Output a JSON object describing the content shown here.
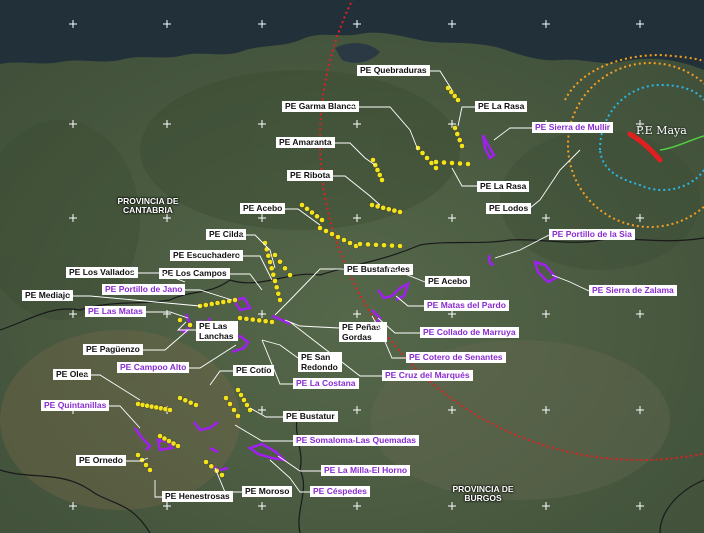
{
  "map": {
    "colors": {
      "land": "#4d5e44",
      "sea": "#22303a",
      "white_label_text": "#111111",
      "purple": "#a020f0",
      "yellow": "#f2e31a",
      "red_circle": "#e02020",
      "orange_circle": "#f5a020",
      "blue_circle": "#2ab8e8",
      "green_line": "#50d040"
    },
    "labels": {
      "quebraduras": "PE Quebraduras",
      "la_rasa_1": "PE La Rasa",
      "garma_blanca": "PE Garma Blanca",
      "sierra_mullir": "PE Sierra de Mullir",
      "amaranta": "PE Amaranta",
      "ribota": "PE Ribota",
      "la_rasa_2": "PE La Rasa",
      "lodos": "PE Lodos",
      "acebo_1": "PE Acebo",
      "cilda": "PE Cilda",
      "portillo_sia": "PE Portillo de la Sia",
      "escuchadero": "PE Escuchadero",
      "los_vallados": "PE Los Vallados",
      "los_campos": "PE Los Campos",
      "bustafrades": "PE Bustafrades",
      "acebo_2": "PE Acebo",
      "sierra_zalama": "PE Sierra de Zalama",
      "mediajo": "PE Mediajo",
      "portillo_jano": "PE Portillo de Jano",
      "matas_pardo": "PE Matas del Pardo",
      "las_matas": "PE Las Matas",
      "las_lanchas": "PE Las Lanchas",
      "penas_gordas": "PE Peñas Gordas",
      "collado_marruya": "PE Collado de Marruya",
      "paguenzo": "PE Pagüenzo",
      "cotero_senantes": "PE Cotero de Senantes",
      "campoo_alto": "PE Campoo Alto",
      "san_redondo": "PE San Redondo",
      "cotio": "PE Cotío",
      "cruz_marques": "PE Cruz del Marqués",
      "olea": "PE Olea",
      "la_costana": "PE La Costana",
      "quintanilla": "PE Quintanillas",
      "bustatur": "PE Bustatur",
      "somaloma": "PE Somaloma-Las Quemadas",
      "ornedo": "PE Ornedo",
      "milla_horno": "PE La Milla-El Horno",
      "henestrosas": "PE Henestrosas",
      "moroso": "PE Moroso",
      "cespedes": "PE Céspedes",
      "prov_cantabria": "PROVINCIA DE CANTABRIA",
      "prov_burgos": "PROVINCIA DE BURGOS",
      "pe_maya": "P.E Maya"
    },
    "icons": [
      "grid-cross-icon",
      "turbine-dot-icon"
    ]
  }
}
